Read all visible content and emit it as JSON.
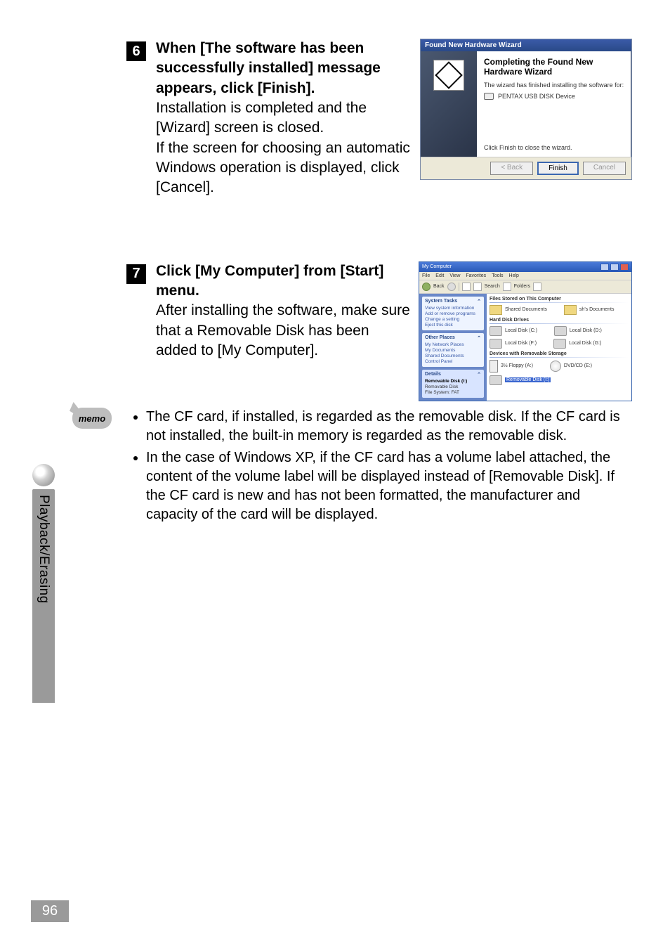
{
  "steps": {
    "s6": {
      "number": "6",
      "heading": "When [The software has been successfully installed] message appears, click [Finish].",
      "line1": "Installation is completed and the [Wizard] screen is closed.",
      "line2": "If the screen for choosing an automatic Windows operation is displayed, click [Cancel]."
    },
    "s7": {
      "number": "7",
      "heading": "Click [My Computer] from [Start] menu.",
      "line1": "After installing the software, make sure that a Removable Disk has been added to [My Computer]."
    }
  },
  "wizard": {
    "title": "Found New Hardware Wizard",
    "heading": "Completing the Found New Hardware Wizard",
    "sub": "The wizard has finished installing the software for:",
    "device": "PENTAX USB DISK Device",
    "click": "Click Finish to close the wizard.",
    "buttons": {
      "back": "< Back",
      "finish": "Finish",
      "cancel": "Cancel"
    }
  },
  "mycomputer": {
    "title": "My Computer",
    "menu": {
      "file": "File",
      "edit": "Edit",
      "view": "View",
      "favorites": "Favorites",
      "tools": "Tools",
      "help": "Help"
    },
    "toolbar": {
      "back": "Back",
      "search": "Search",
      "folders": "Folders"
    },
    "side": {
      "tasks": {
        "title": "System Tasks",
        "i1": "View system information",
        "i2": "Add or remove programs",
        "i3": "Change a setting",
        "i4": "Eject this disk"
      },
      "places": {
        "title": "Other Places",
        "i1": "My Network Places",
        "i2": "My Documents",
        "i3": "Shared Documents",
        "i4": "Control Panel"
      },
      "details": {
        "title": "Details",
        "l1": "Removable Disk (I:)",
        "l2": "Removable Disk",
        "l3": "File System: FAT"
      }
    },
    "main": {
      "sec1": "Files Stored on This Computer",
      "shared": "Shared Documents",
      "mydocs": "sh's Documents",
      "sec2": "Hard Disk Drives",
      "c": "Local Disk (C:)",
      "d": "Local Disk (D:)",
      "f": "Local Disk (F:)",
      "g": "Local Disk (G:)",
      "sec3": "Devices with Removable Storage",
      "floppy": "3½ Floppy (A:)",
      "dvd": "DVD/CD (E:)",
      "remdisk": "Removable Disk (I:)"
    }
  },
  "memo": {
    "label": "memo",
    "bullet1": "The CF card, if installed, is regarded as the removable disk. If the CF card is not installed, the built-in memory is regarded as the removable disk.",
    "bullet2": "In the case of Windows XP, if the CF card has a volume label attached, the content of the volume label will be displayed instead of [Removable Disk]. If the CF card is new and has not been formatted, the manufacturer and capacity of the card will be displayed."
  },
  "sidetab": {
    "label": "Playback/Erasing"
  },
  "page_number": "96"
}
